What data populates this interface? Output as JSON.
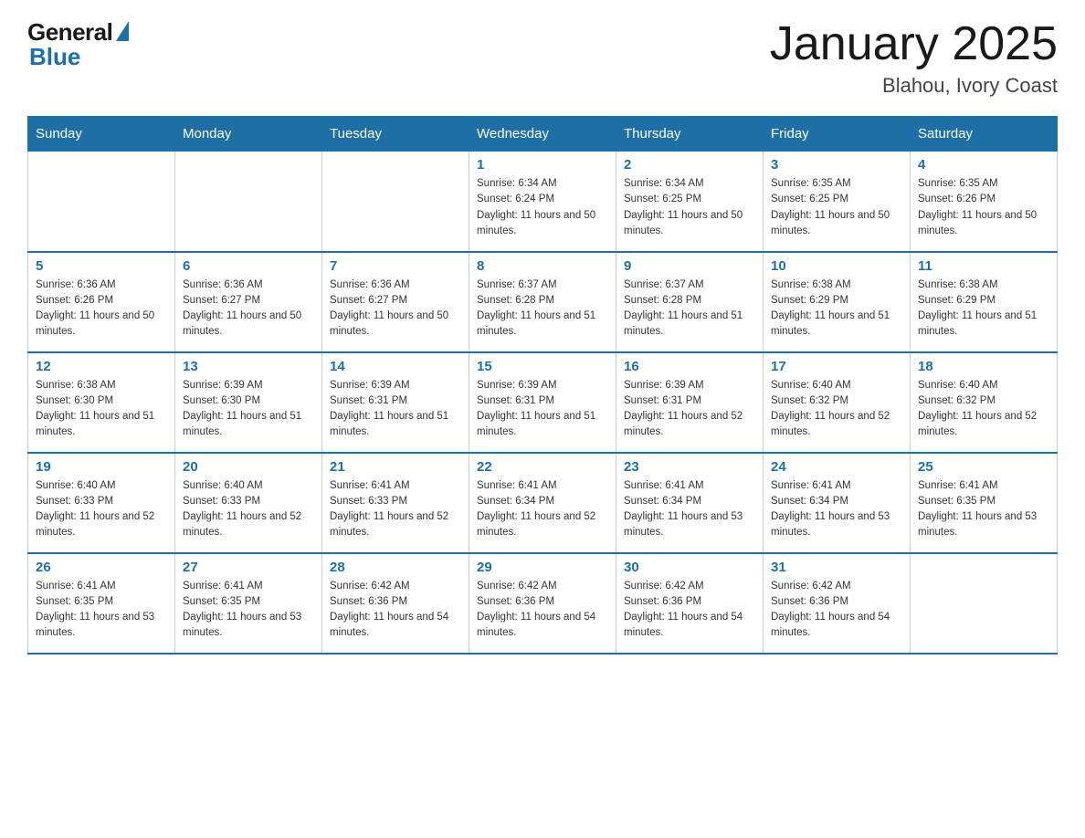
{
  "logo": {
    "general": "General",
    "blue": "Blue"
  },
  "title": "January 2025",
  "subtitle": "Blahou, Ivory Coast",
  "days_of_week": [
    "Sunday",
    "Monday",
    "Tuesday",
    "Wednesday",
    "Thursday",
    "Friday",
    "Saturday"
  ],
  "weeks": [
    [
      {
        "day": "",
        "info": ""
      },
      {
        "day": "",
        "info": ""
      },
      {
        "day": "",
        "info": ""
      },
      {
        "day": "1",
        "info": "Sunrise: 6:34 AM\nSunset: 6:24 PM\nDaylight: 11 hours and 50 minutes."
      },
      {
        "day": "2",
        "info": "Sunrise: 6:34 AM\nSunset: 6:25 PM\nDaylight: 11 hours and 50 minutes."
      },
      {
        "day": "3",
        "info": "Sunrise: 6:35 AM\nSunset: 6:25 PM\nDaylight: 11 hours and 50 minutes."
      },
      {
        "day": "4",
        "info": "Sunrise: 6:35 AM\nSunset: 6:26 PM\nDaylight: 11 hours and 50 minutes."
      }
    ],
    [
      {
        "day": "5",
        "info": "Sunrise: 6:36 AM\nSunset: 6:26 PM\nDaylight: 11 hours and 50 minutes."
      },
      {
        "day": "6",
        "info": "Sunrise: 6:36 AM\nSunset: 6:27 PM\nDaylight: 11 hours and 50 minutes."
      },
      {
        "day": "7",
        "info": "Sunrise: 6:36 AM\nSunset: 6:27 PM\nDaylight: 11 hours and 50 minutes."
      },
      {
        "day": "8",
        "info": "Sunrise: 6:37 AM\nSunset: 6:28 PM\nDaylight: 11 hours and 51 minutes."
      },
      {
        "day": "9",
        "info": "Sunrise: 6:37 AM\nSunset: 6:28 PM\nDaylight: 11 hours and 51 minutes."
      },
      {
        "day": "10",
        "info": "Sunrise: 6:38 AM\nSunset: 6:29 PM\nDaylight: 11 hours and 51 minutes."
      },
      {
        "day": "11",
        "info": "Sunrise: 6:38 AM\nSunset: 6:29 PM\nDaylight: 11 hours and 51 minutes."
      }
    ],
    [
      {
        "day": "12",
        "info": "Sunrise: 6:38 AM\nSunset: 6:30 PM\nDaylight: 11 hours and 51 minutes."
      },
      {
        "day": "13",
        "info": "Sunrise: 6:39 AM\nSunset: 6:30 PM\nDaylight: 11 hours and 51 minutes."
      },
      {
        "day": "14",
        "info": "Sunrise: 6:39 AM\nSunset: 6:31 PM\nDaylight: 11 hours and 51 minutes."
      },
      {
        "day": "15",
        "info": "Sunrise: 6:39 AM\nSunset: 6:31 PM\nDaylight: 11 hours and 51 minutes."
      },
      {
        "day": "16",
        "info": "Sunrise: 6:39 AM\nSunset: 6:31 PM\nDaylight: 11 hours and 52 minutes."
      },
      {
        "day": "17",
        "info": "Sunrise: 6:40 AM\nSunset: 6:32 PM\nDaylight: 11 hours and 52 minutes."
      },
      {
        "day": "18",
        "info": "Sunrise: 6:40 AM\nSunset: 6:32 PM\nDaylight: 11 hours and 52 minutes."
      }
    ],
    [
      {
        "day": "19",
        "info": "Sunrise: 6:40 AM\nSunset: 6:33 PM\nDaylight: 11 hours and 52 minutes."
      },
      {
        "day": "20",
        "info": "Sunrise: 6:40 AM\nSunset: 6:33 PM\nDaylight: 11 hours and 52 minutes."
      },
      {
        "day": "21",
        "info": "Sunrise: 6:41 AM\nSunset: 6:33 PM\nDaylight: 11 hours and 52 minutes."
      },
      {
        "day": "22",
        "info": "Sunrise: 6:41 AM\nSunset: 6:34 PM\nDaylight: 11 hours and 52 minutes."
      },
      {
        "day": "23",
        "info": "Sunrise: 6:41 AM\nSunset: 6:34 PM\nDaylight: 11 hours and 53 minutes."
      },
      {
        "day": "24",
        "info": "Sunrise: 6:41 AM\nSunset: 6:34 PM\nDaylight: 11 hours and 53 minutes."
      },
      {
        "day": "25",
        "info": "Sunrise: 6:41 AM\nSunset: 6:35 PM\nDaylight: 11 hours and 53 minutes."
      }
    ],
    [
      {
        "day": "26",
        "info": "Sunrise: 6:41 AM\nSunset: 6:35 PM\nDaylight: 11 hours and 53 minutes."
      },
      {
        "day": "27",
        "info": "Sunrise: 6:41 AM\nSunset: 6:35 PM\nDaylight: 11 hours and 53 minutes."
      },
      {
        "day": "28",
        "info": "Sunrise: 6:42 AM\nSunset: 6:36 PM\nDaylight: 11 hours and 54 minutes."
      },
      {
        "day": "29",
        "info": "Sunrise: 6:42 AM\nSunset: 6:36 PM\nDaylight: 11 hours and 54 minutes."
      },
      {
        "day": "30",
        "info": "Sunrise: 6:42 AM\nSunset: 6:36 PM\nDaylight: 11 hours and 54 minutes."
      },
      {
        "day": "31",
        "info": "Sunrise: 6:42 AM\nSunset: 6:36 PM\nDaylight: 11 hours and 54 minutes."
      },
      {
        "day": "",
        "info": ""
      }
    ]
  ]
}
